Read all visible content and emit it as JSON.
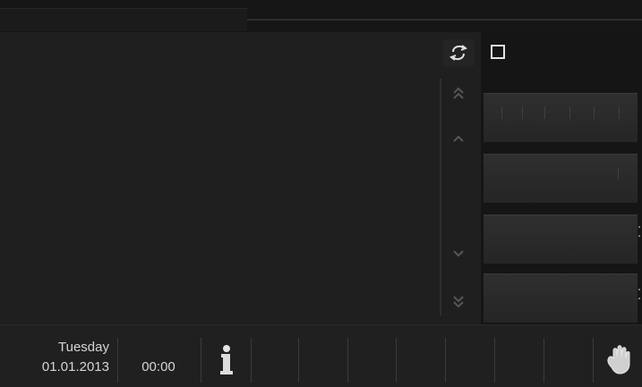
{
  "header": {
    "title": ""
  },
  "controls": {
    "refresh_icon": "refresh-icon",
    "window_icon": "square-icon",
    "scroll_icons": [
      "double-chevron-up-icon",
      "chevron-up-icon",
      "chevron-down-icon",
      "double-chevron-down-icon"
    ]
  },
  "status": {
    "day": "Tuesday",
    "date": "01.01.2013",
    "time": "00:00"
  },
  "bottom_icons": {
    "info_icon": "info-icon",
    "hand_icon": "hand-icon"
  },
  "colors": {
    "background": "#151515",
    "panel": "#1f1f1f",
    "tile": "#2b2b2b",
    "text": "#d5d5d5",
    "divider": "#3a3a3a"
  }
}
